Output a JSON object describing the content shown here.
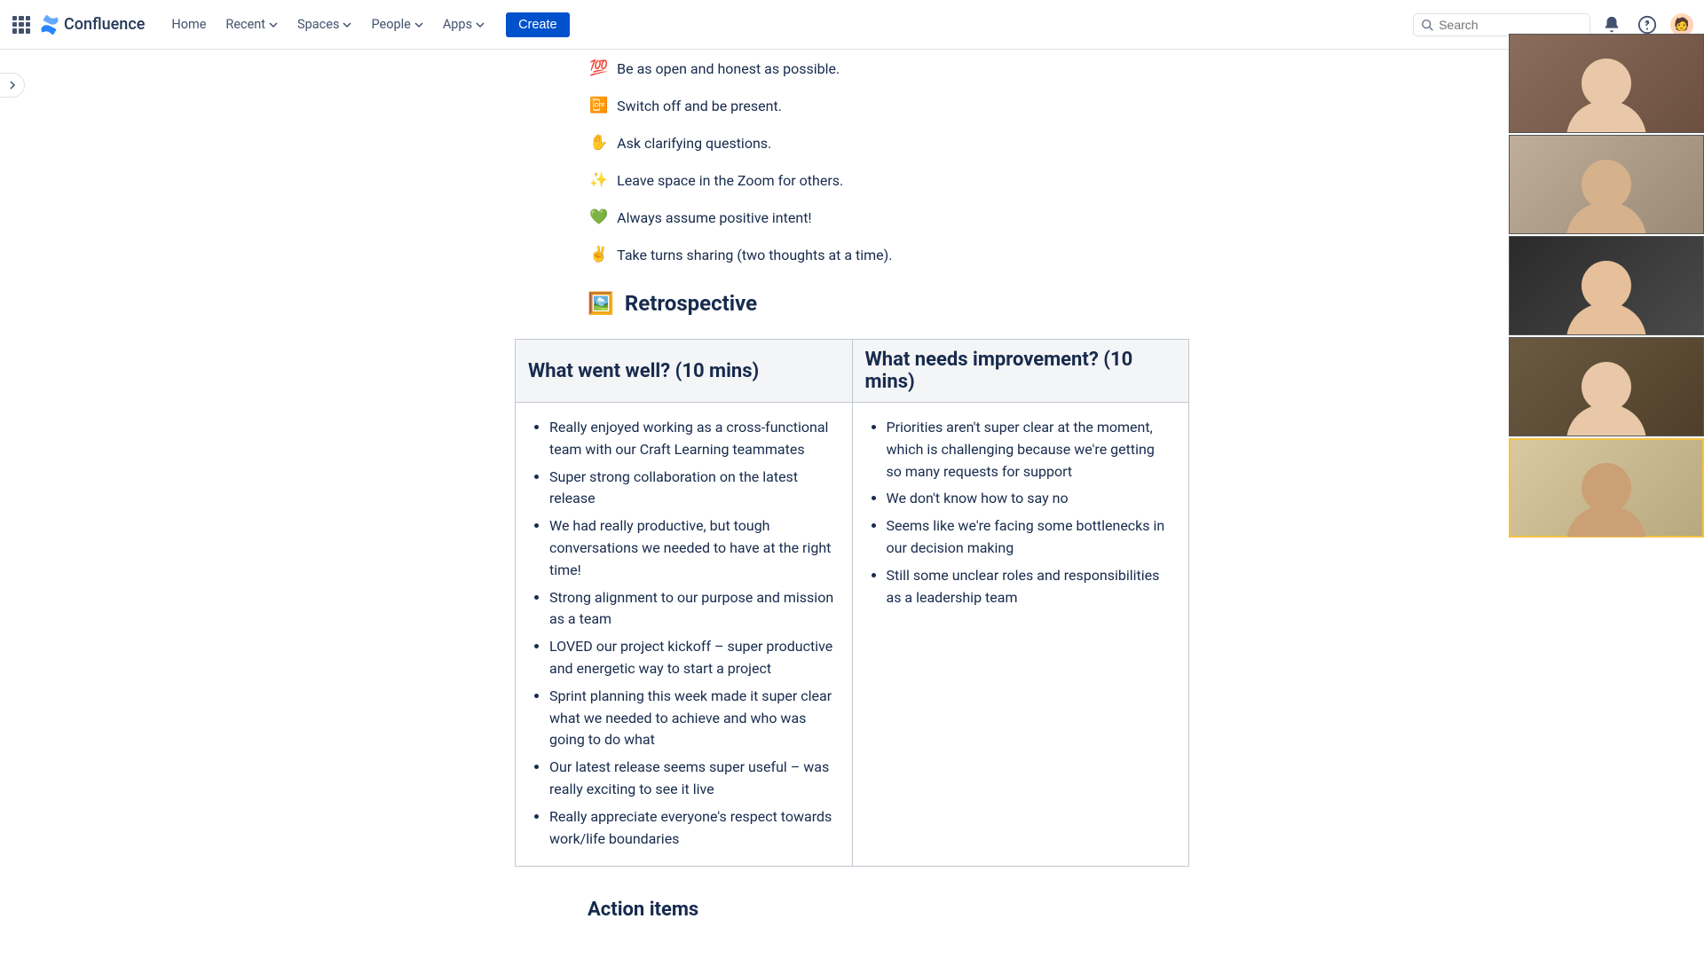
{
  "brand": {
    "name": "Confluence"
  },
  "nav": {
    "home": "Home",
    "recent": "Recent",
    "spaces": "Spaces",
    "people": "People",
    "apps": "Apps",
    "create": "Create"
  },
  "search": {
    "placeholder": "Search"
  },
  "rules": [
    {
      "emoji": "💯",
      "text": "Be as open and honest as possible."
    },
    {
      "emoji": "📴",
      "text": "Switch off and be present."
    },
    {
      "emoji": "✋",
      "text": "Ask clarifying questions."
    },
    {
      "emoji": "✨",
      "text": "Leave space in the Zoom for others."
    },
    {
      "emoji": "💚",
      "text": "Always assume positive intent!"
    },
    {
      "emoji": "✌️",
      "text": "Take turns sharing (two thoughts at a time)."
    }
  ],
  "retro": {
    "icon": "🖼️",
    "heading": "Retrospective",
    "col1_heading": "What went well? (10 mins)",
    "col2_heading": "What needs improvement? (10 mins)",
    "went_well": [
      "Really enjoyed working as a cross-functional team with our Craft Learning teammates",
      "Super strong collaboration on the latest release",
      "We had really productive, but tough conversations we needed to have at the right time!",
      "Strong alignment to our purpose and mission as a team",
      "LOVED our project kickoff – super productive and energetic way to start a project",
      "Sprint planning this week made it super clear what we needed to achieve and who was going to do what",
      "Our latest release seems super useful – was really exciting to see it live",
      "Really appreciate everyone's respect towards work/life boundaries"
    ],
    "improve": [
      "Priorities aren't super clear at the moment, which is challenging because we're getting so many requests for support",
      "We don't know how to say no",
      "Seems like we're facing some bottlenecks in our decision making",
      "Still some unclear roles and responsibilities as a leadership team"
    ]
  },
  "action_items": {
    "heading": "Action items"
  },
  "video_participants": [
    {
      "bg": "linear-gradient(135deg,#8b6d5c,#6b4f3f)",
      "skin": "#e8c8a8",
      "active": false
    },
    {
      "bg": "linear-gradient(135deg,#bfae9a,#9a8976)",
      "skin": "#d6b28c",
      "active": false
    },
    {
      "bg": "linear-gradient(135deg,#2a2a2a,#4a4a4a)",
      "skin": "#e6c09a",
      "active": false
    },
    {
      "bg": "linear-gradient(135deg,#6b5a42,#4f3f2a)",
      "skin": "#e8c8a8",
      "active": false
    },
    {
      "bg": "linear-gradient(135deg,#d9c9a0,#b8a880)",
      "skin": "#caa074",
      "active": true
    }
  ]
}
